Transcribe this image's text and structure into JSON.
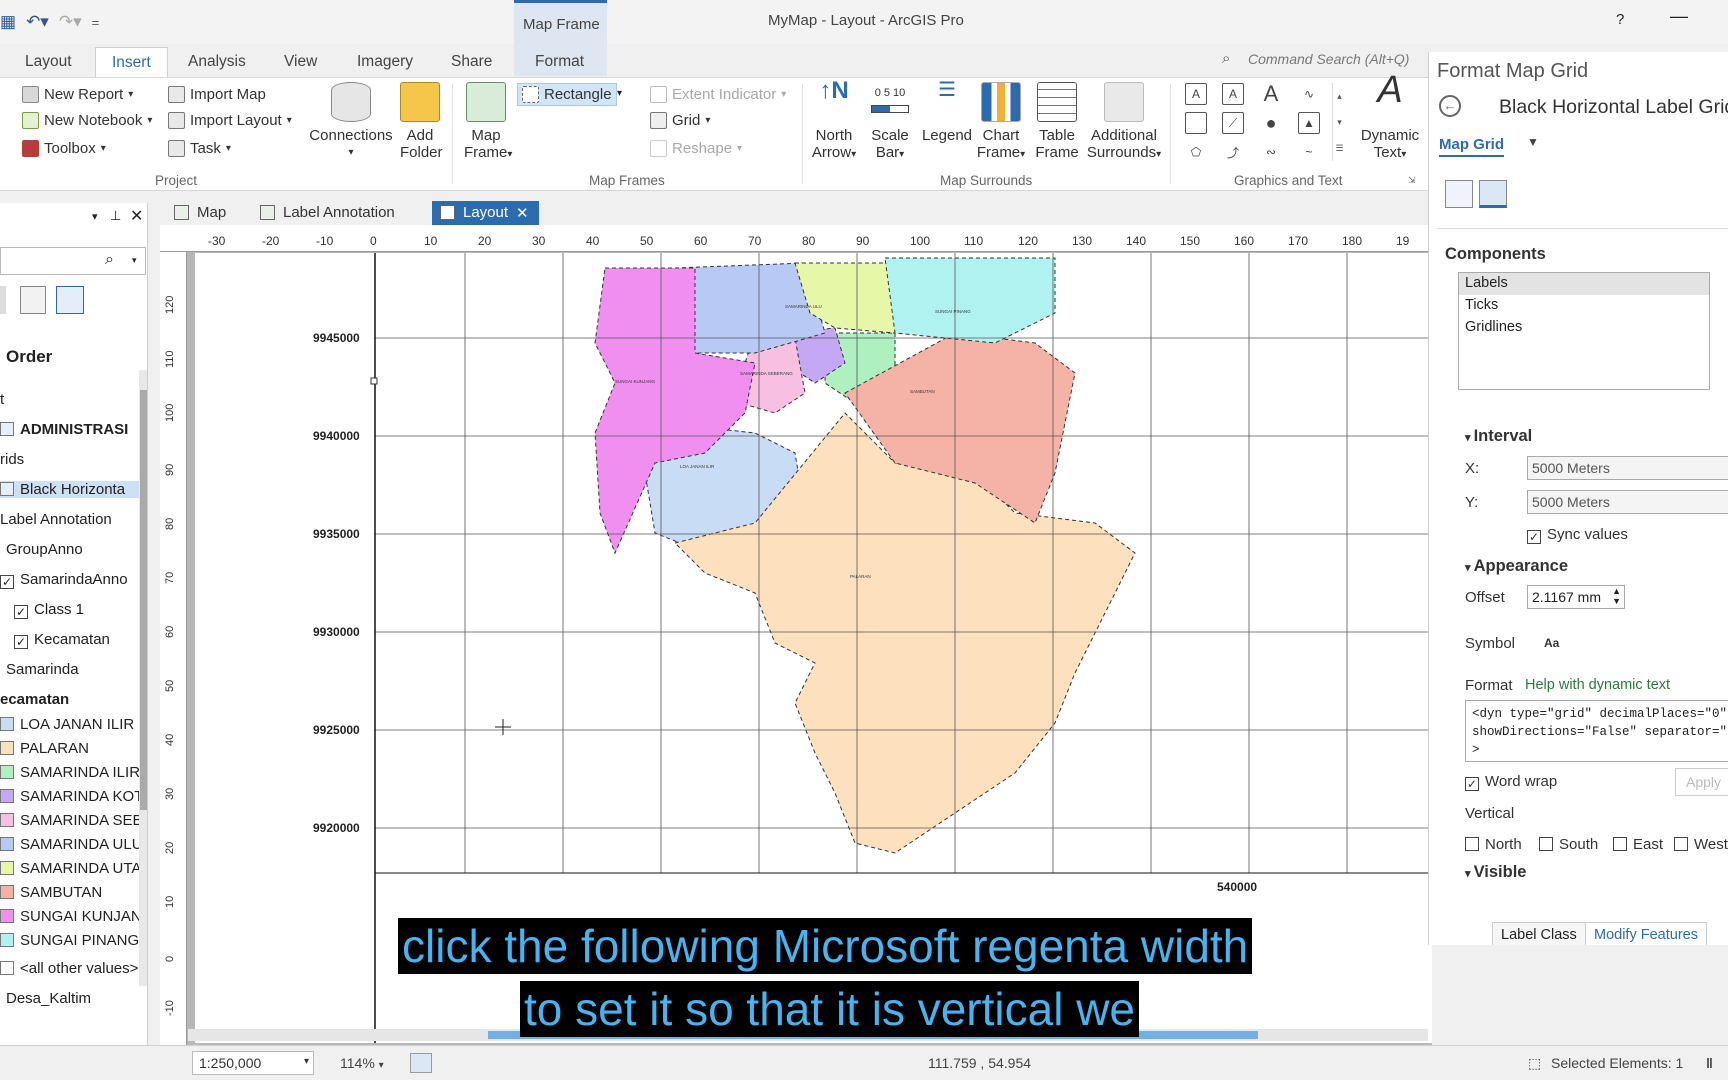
{
  "app": {
    "title": "MyMap - Layout - ArcGIS Pro",
    "help": "?",
    "minimize": "—"
  },
  "contextual_group": {
    "label": "Map Frame"
  },
  "ribbon_tabs": [
    "Layout",
    "Insert",
    "Analysis",
    "View",
    "Imagery",
    "Share",
    "Format"
  ],
  "active_tab": "Insert",
  "command_search": {
    "placeholder": "Command Search (Alt+Q)"
  },
  "ribbon": {
    "project": {
      "label": "Project",
      "new_report": "New Report",
      "new_notebook": "New Notebook",
      "toolbox": "Toolbox",
      "import_map": "Import Map",
      "import_layout": "Import Layout",
      "task": "Task",
      "connections": "Connections",
      "add_folder_1": "Add",
      "add_folder_2": "Folder"
    },
    "map_frames": {
      "label": "Map Frames",
      "map_frame_1": "Map",
      "map_frame_2": "Frame",
      "rectangle": "Rectangle",
      "extent_indicator": "Extent Indicator",
      "grid": "Grid",
      "reshape": "Reshape"
    },
    "map_surrounds": {
      "label": "Map Surrounds",
      "north_arrow_1": "North",
      "north_arrow_2": "Arrow",
      "scale_bar_1": "Scale",
      "scale_bar_2": "Bar",
      "scale_bar_ticks": "0  5  10",
      "legend": "Legend",
      "chart_frame_1": "Chart",
      "chart_frame_2": "Frame",
      "table_frame_1": "Table",
      "table_frame_2": "Frame",
      "additional_1": "Additional",
      "additional_2": "Surrounds"
    },
    "graphics_text": {
      "label": "Graphics and Text",
      "dynamic_text_1": "Dynamic",
      "dynamic_text_2": "Text"
    }
  },
  "doc_tabs": [
    {
      "label": "Map"
    },
    {
      "label": "Label Annotation"
    },
    {
      "label": "Layout",
      "close": "✕"
    }
  ],
  "contents_pane": {
    "title": "Order",
    "rows": [
      {
        "text": "t"
      },
      {
        "text": "ADMINISTRASI",
        "bold": true
      },
      {
        "text": "rids"
      },
      {
        "text": "Black Horizonta"
      },
      {
        "text": "Label Annotation"
      },
      {
        "text": "GroupAnno"
      },
      {
        "text": "SamarindaAnno",
        "check": "✓"
      },
      {
        "text": "Class 1",
        "check": "✓"
      },
      {
        "text": "Kecamatan",
        "check": "✓"
      },
      {
        "text": "Samarinda"
      },
      {
        "text": "ecamatan",
        "bold": true
      },
      {
        "text": "LOA JANAN ILIR",
        "color": "#c9dcf5"
      },
      {
        "text": "PALARAN",
        "color": "#fde0bd"
      },
      {
        "text": "SAMARINDA ILIR",
        "color": "#aef0c0"
      },
      {
        "text": "SAMARINDA KOT",
        "color": "#c4a8f5"
      },
      {
        "text": "SAMARINDA SEB",
        "color": "#f7c0e3"
      },
      {
        "text": "SAMARINDA ULU",
        "color": "#b9c9f5"
      },
      {
        "text": "SAMARINDA UTA",
        "color": "#e6f7a8"
      },
      {
        "text": "SAMBUTAN",
        "color": "#f5b3a8"
      },
      {
        "text": "SUNGAI KUNJAN",
        "color": "#f08ff0"
      },
      {
        "text": "SUNGAI PINANG",
        "color": "#b0f2f0"
      },
      {
        "text": "<all other values>",
        "color": "#ffffff"
      },
      {
        "text": "Desa_Kaltim"
      }
    ]
  },
  "ruler": {
    "h": [
      "-30",
      "-20",
      "-10",
      "0",
      "10",
      "20",
      "30",
      "40",
      "50",
      "60",
      "70",
      "80",
      "90",
      "100",
      "110",
      "120",
      "130",
      "140",
      "150",
      "160",
      "170",
      "180",
      "19"
    ],
    "v": [
      "120",
      "110",
      "100",
      "90",
      "80",
      "70",
      "60",
      "50",
      "40",
      "30",
      "20",
      "10",
      "0",
      "-10"
    ]
  },
  "map": {
    "grid_labels_y": [
      "9945000",
      "9940000",
      "9935000",
      "9930000",
      "9925000",
      "9920000"
    ],
    "grid_label_x": "540000",
    "district_labels": [
      "SUNGAI KUNJANG",
      "SAMARINDA SEBERANG",
      "LOA JANAN ILIR",
      "SAMBUTAN",
      "PALARAN",
      "SUNGAI PINANG",
      "SAMARINDA ULU"
    ]
  },
  "format_pane": {
    "title": "Format Map Grid",
    "element": "Black Horizontal Label Grid",
    "selector": "Map Grid",
    "components_title": "Components",
    "components": [
      "Labels",
      "Ticks",
      "Gridlines"
    ],
    "interval": {
      "title": "Interval",
      "x_label": "X:",
      "x_value": "5000 Meters",
      "y_label": "Y:",
      "y_value": "5000 Meters",
      "sync_label": "Sync values",
      "sync_checked": "✓"
    },
    "appearance": {
      "title": "Appearance",
      "offset_label": "Offset",
      "offset_value": "2.1167 mm",
      "symbol_label": "Symbol",
      "symbol_value": "Aa",
      "format_label": "Format",
      "format_link": "Help with dynamic text",
      "format_text": "<dyn type=\"grid\" decimalPlaces=\"0\"\nshowDirections=\"False\" separator=\"False\"\n>",
      "word_wrap_label": "Word wrap",
      "word_wrap_checked": "✓",
      "apply_button": "Apply",
      "vertical_label": "Vertical",
      "dirs": [
        "North",
        "South",
        "East",
        "West"
      ]
    },
    "visible_title": "Visible",
    "footer_tabs": [
      "Label Class",
      "Modify Features"
    ],
    "behind_tab": "Modify Features"
  },
  "status": {
    "scale": "1:250,000",
    "zoom": "114%",
    "coords": "111.759 , 54.954",
    "selected": "Selected Elements: 1"
  },
  "caption": {
    "line1": "click the following Microsoft regenta width",
    "line2": "to set it so that it is vertical we"
  }
}
